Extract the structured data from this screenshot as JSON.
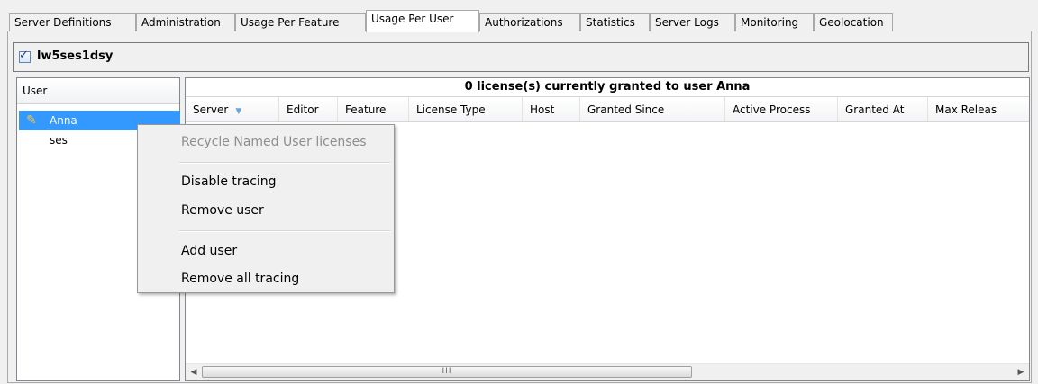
{
  "tabs": [
    {
      "label": "Server Definitions",
      "active": false
    },
    {
      "label": "Administration",
      "active": false
    },
    {
      "label": "Usage Per Feature",
      "active": false
    },
    {
      "label": "Usage Per User",
      "active": true
    },
    {
      "label": "Authorizations",
      "active": false
    },
    {
      "label": "Statistics",
      "active": false
    },
    {
      "label": "Server Logs",
      "active": false
    },
    {
      "label": "Monitoring",
      "active": false
    },
    {
      "label": "Geolocation",
      "active": false
    }
  ],
  "server": {
    "name": "lw5ses1dsy",
    "checked": true
  },
  "user_list": {
    "header": "User",
    "users": [
      {
        "name": "Anna",
        "selected": true
      },
      {
        "name": "ses",
        "selected": false
      }
    ]
  },
  "grid": {
    "title": "0 license(s) currently granted to user Anna",
    "columns": [
      "Server",
      "Editor",
      "Feature",
      "License Type",
      "Host",
      "Granted Since",
      "Active Process",
      "Granted At",
      "Max Releas"
    ],
    "scroll_thumb_label": "III"
  },
  "context_menu": {
    "items": [
      {
        "label": "Recycle Named User licenses",
        "enabled": false
      },
      {
        "label": "Disable tracing",
        "enabled": true
      },
      {
        "label": "Remove user",
        "enabled": true
      },
      {
        "label": "Add user",
        "enabled": true
      },
      {
        "label": "Remove all tracing",
        "enabled": true
      }
    ]
  },
  "colors": {
    "selection": "#3399ff",
    "accent": "#6fa3d8"
  }
}
